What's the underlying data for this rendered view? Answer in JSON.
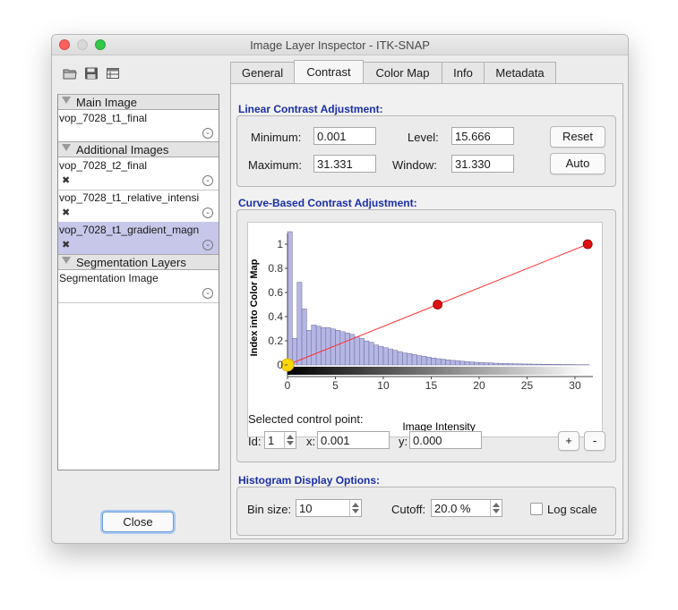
{
  "window": {
    "title": "Image Layer Inspector - ITK-SNAP"
  },
  "toolbar": {
    "icons": [
      "open-folder-icon",
      "save-icon",
      "layout-table-icon"
    ]
  },
  "layers": {
    "groups": [
      {
        "label": "Main Image",
        "items": [
          {
            "name": "vop_7028_t1_final",
            "pinned": false,
            "selected": false
          }
        ]
      },
      {
        "label": "Additional Images",
        "items": [
          {
            "name": "vop_7028_t2_final",
            "pinned": true,
            "selected": false
          },
          {
            "name": "vop_7028_t1_relative_intensi",
            "pinned": true,
            "selected": false
          },
          {
            "name": "vop_7028_t1_gradient_magn",
            "pinned": true,
            "selected": true
          }
        ]
      },
      {
        "label": "Segmentation Layers",
        "items": [
          {
            "name": "Segmentation Image",
            "pinned": false,
            "selected": false
          }
        ]
      }
    ]
  },
  "close_label": "Close",
  "tabs": [
    {
      "label": "General",
      "active": false
    },
    {
      "label": "Contrast",
      "active": true
    },
    {
      "label": "Color Map",
      "active": false
    },
    {
      "label": "Info",
      "active": false
    },
    {
      "label": "Metadata",
      "active": false
    }
  ],
  "linear": {
    "title": "Linear Contrast Adjustment:",
    "minimum_label": "Minimum:",
    "minimum": "0.001",
    "maximum_label": "Maximum:",
    "maximum": "31.331",
    "level_label": "Level:",
    "level": "15.666",
    "window_label": "Window:",
    "window": "31.330",
    "reset_label": "Reset",
    "auto_label": "Auto"
  },
  "curve": {
    "title": "Curve-Based Contrast Adjustment:",
    "selected_label": "Selected control point:",
    "id_label": "Id:",
    "id": "1",
    "x_label": "x:",
    "x": "0.001",
    "y_label": "y:",
    "y": "0.000",
    "plus_label": "+",
    "minus_label": "-"
  },
  "histogram": {
    "title": "Histogram Display Options:",
    "bin_label": "Bin size:",
    "bin": "10",
    "cutoff_label": "Cutoff:",
    "cutoff": "20.0 %",
    "log_label": "Log scale",
    "log_checked": false
  },
  "chart_data": {
    "type": "line",
    "xlabel": "Image Intensity",
    "ylabel": "Index into Color Map",
    "xlim": [
      0,
      31.5
    ],
    "ylim": [
      0,
      1
    ],
    "xticks": [
      0,
      5,
      10,
      15,
      20,
      25,
      30
    ],
    "yticks": [
      0,
      0.2,
      0.4,
      0.6,
      0.8,
      1
    ],
    "series": [
      {
        "points": [
          [
            0.001,
            0.0
          ],
          [
            15.666,
            0.5
          ],
          [
            31.331,
            1.0
          ]
        ],
        "color": "#ff3333"
      }
    ],
    "control_points": [
      {
        "x": 0.001,
        "y": 0.0,
        "selected": true,
        "color": "#ffd700"
      },
      {
        "x": 15.666,
        "y": 0.5,
        "selected": false,
        "color": "#dd1111"
      },
      {
        "x": 31.331,
        "y": 1.0,
        "selected": false,
        "color": "#dd1111"
      }
    ],
    "histogram": {
      "color": "#b6b6e4",
      "bin_start": 0,
      "bin_width": 0.5,
      "heights": [
        1.0,
        0.2,
        0.62,
        0.42,
        0.26,
        0.3,
        0.29,
        0.28,
        0.28,
        0.27,
        0.26,
        0.25,
        0.24,
        0.23,
        0.21,
        0.2,
        0.18,
        0.17,
        0.15,
        0.14,
        0.13,
        0.12,
        0.11,
        0.1,
        0.09,
        0.085,
        0.078,
        0.07,
        0.065,
        0.058,
        0.052,
        0.047,
        0.043,
        0.038,
        0.034,
        0.031,
        0.028,
        0.025,
        0.022,
        0.02,
        0.018,
        0.016,
        0.015,
        0.013,
        0.012,
        0.011,
        0.01,
        0.009,
        0.008,
        0.007,
        0.007,
        0.006,
        0.006,
        0.005,
        0.005,
        0.004,
        0.004,
        0.003,
        0.003,
        0.003,
        0.002,
        0.002,
        0.002
      ]
    },
    "colorbar": "grayscale"
  }
}
